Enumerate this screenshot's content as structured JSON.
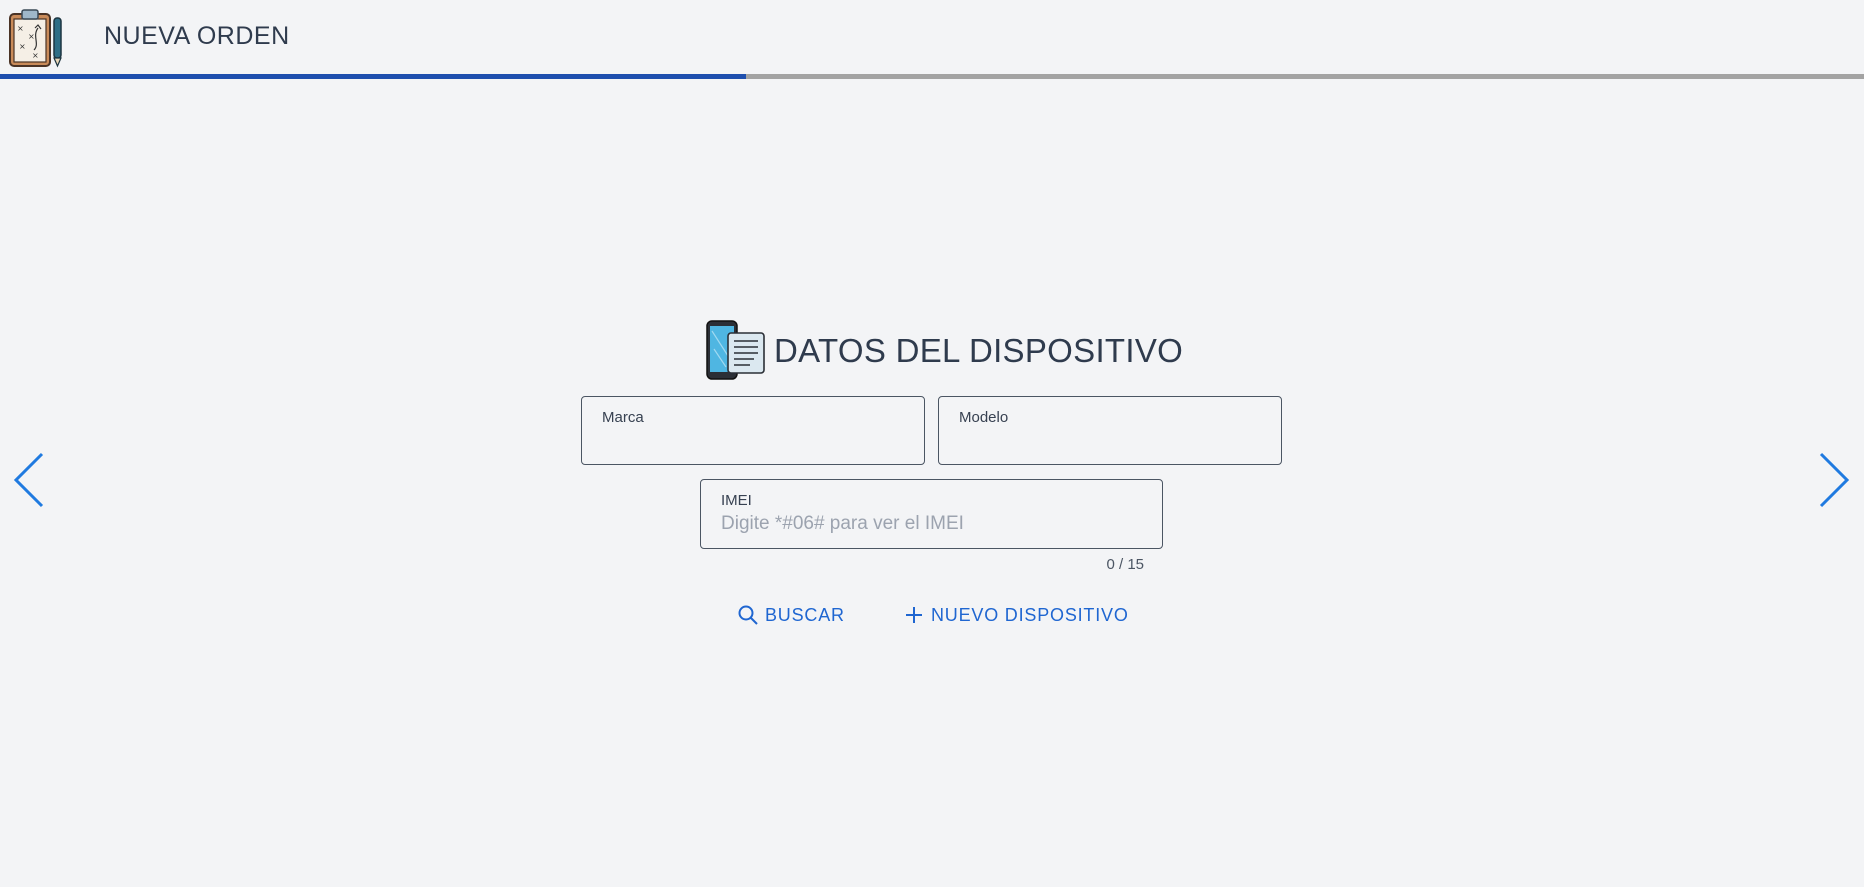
{
  "header": {
    "title": "NUEVA ORDEN",
    "logo_icon": "clipboard-strategy-icon"
  },
  "progress": {
    "fraction": 0.4,
    "fill_color": "#1e4fae",
    "track_color": "#a3a3a3"
  },
  "section": {
    "title": "DATOS DEL DISPOSITIVO",
    "icon": "phone-document-icon"
  },
  "fields": {
    "marca": {
      "label": "Marca",
      "value": "",
      "placeholder": ""
    },
    "modelo": {
      "label": "Modelo",
      "value": "",
      "placeholder": ""
    },
    "imei": {
      "label": "IMEI",
      "value": "",
      "placeholder": "Digite *#06# para ver el IMEI",
      "counter": "0 / 15"
    }
  },
  "actions": {
    "search_label": "BUSCAR",
    "new_device_label": "NUEVO DISPOSITIVO"
  },
  "nav": {
    "prev_icon": "chevron-left-icon",
    "next_icon": "chevron-right-icon"
  },
  "colors": {
    "accent": "#1f66d1",
    "background": "#f3f4f6",
    "text": "#2f3b4d"
  }
}
